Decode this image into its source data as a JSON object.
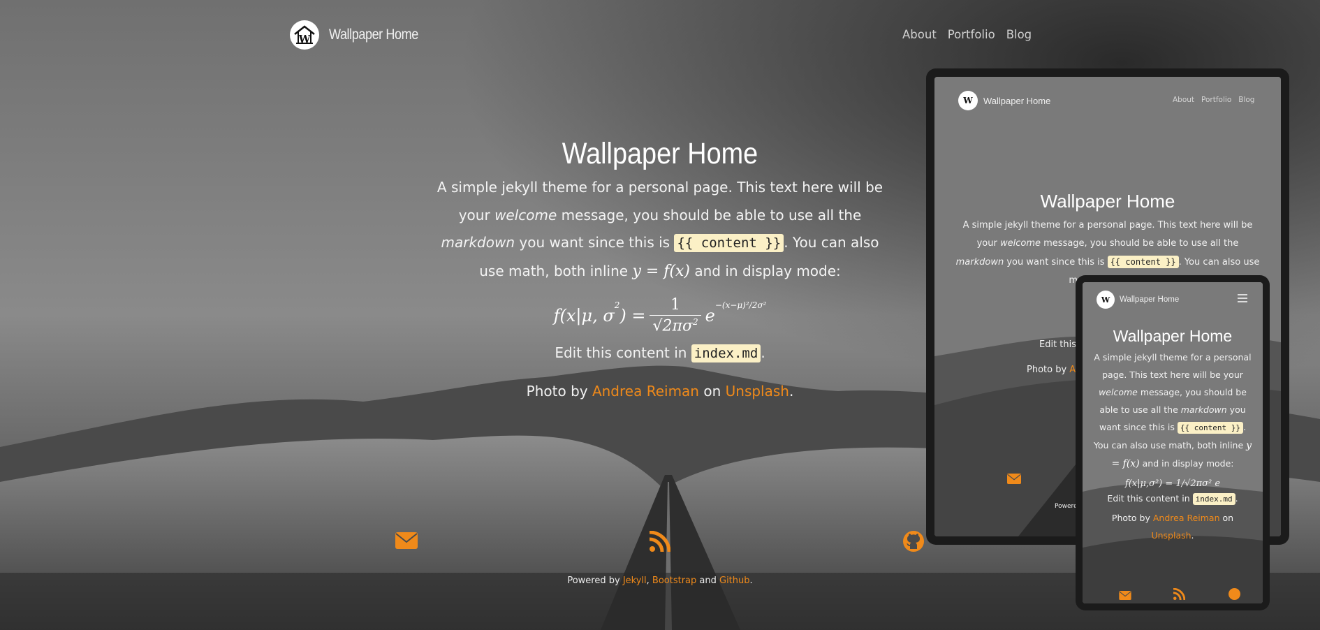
{
  "site": {
    "title": "Wallpaper Home",
    "logo": "house-w-logo-icon"
  },
  "nav": {
    "items": [
      "About",
      "Portfolio",
      "Blog"
    ]
  },
  "main": {
    "title": "Wallpaper Home",
    "welcome_1": "A simple jekyll theme for a personal page. This text here will be your",
    "welcome_em1": "welcome",
    "welcome_2": " message, you should be able to use all the ",
    "welcome_em2": "markdown",
    "welcome_3": " you want since this is ",
    "content_code": "{{ content }}",
    "welcome_4": ". You can also use math, both inline ",
    "inline_math": "y = f(x)",
    "welcome_5": " and in display mode:",
    "edit_prefix": "Edit this content in ",
    "edit_code": "index.md",
    "edit_suffix": ".",
    "photo_prefix": "Photo by ",
    "photographer": "Andrea Reiman",
    "photo_on": " on ",
    "photo_source": "Unsplash",
    "photo_suffix": "."
  },
  "footer": {
    "icons": [
      "envelope-icon",
      "rss-icon",
      "github-icon"
    ],
    "powered_prefix": "Powered by ",
    "jekyll": "Jekyll",
    "sep1": ", ",
    "bootstrap": "Bootstrap",
    "sep2": " and ",
    "github": "Github",
    "end": "."
  },
  "tablet": {
    "title": "Wallpaper Home",
    "nav": [
      "About",
      "Portfolio",
      "Blog"
    ],
    "photo_prefix": "Photo by ",
    "photographer_partial": "An",
    "edit_partial": "Edit this",
    "powered_partial": "Powered"
  },
  "phone": {
    "title": "Wallpaper Home",
    "menu_icon": "hamburger-menu-icon"
  },
  "colors": {
    "accent": "#f08a1a",
    "code_bg": "#fbf0c6"
  }
}
